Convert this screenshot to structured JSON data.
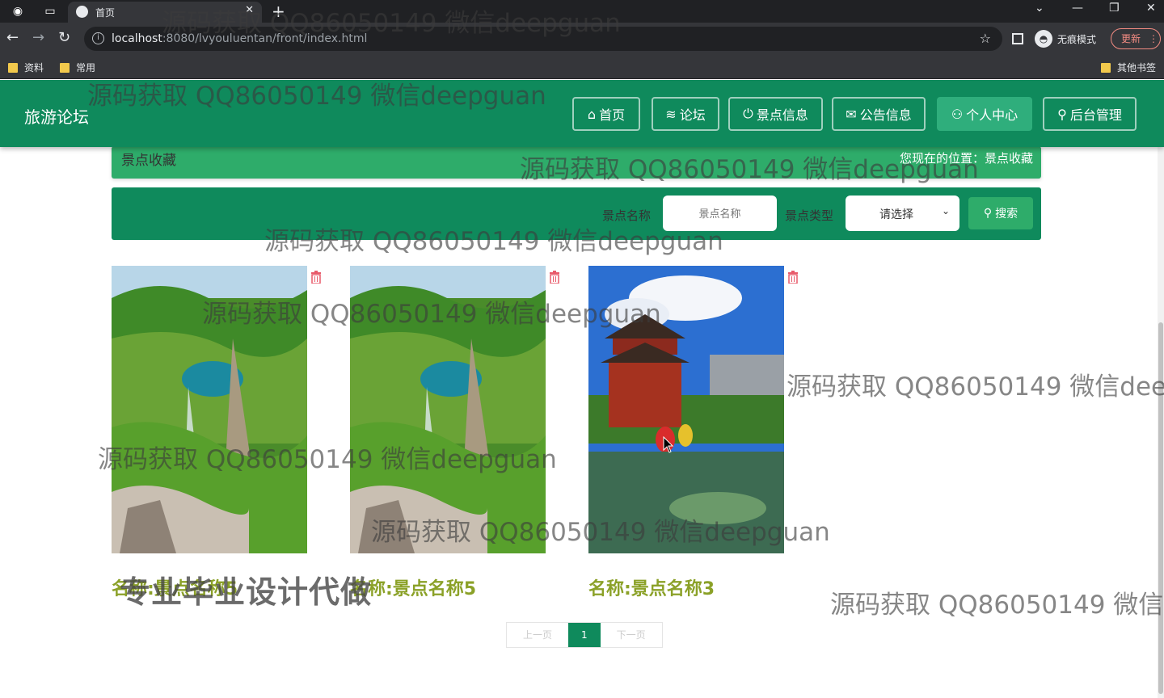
{
  "browser": {
    "tab_title": "首页",
    "url_host": "localhost",
    "url_rest": ":8080/lvyouluentan/front/index.html",
    "incognito_label": "无痕模式",
    "update_label": "更新",
    "bookmarks": [
      "资料",
      "常用"
    ],
    "other_bookmarks": "其他书签"
  },
  "site": {
    "logo": "旅游论坛",
    "nav": [
      {
        "label": "首页",
        "icon": "home-icon"
      },
      {
        "label": "论坛",
        "icon": "layers-icon"
      },
      {
        "label": "景点信息",
        "icon": "power-icon"
      },
      {
        "label": "公告信息",
        "icon": "mail-icon"
      },
      {
        "label": "个人中心",
        "icon": "user-icon",
        "active": true
      },
      {
        "label": "后台管理",
        "icon": "link-icon"
      }
    ]
  },
  "breadcrumb": {
    "title": "景点收藏",
    "location_prefix": "您现在的位置：",
    "location": "景点收藏"
  },
  "search": {
    "name_label": "景点名称",
    "name_placeholder": "景点名称",
    "type_label": "景点类型",
    "type_value": "请选择",
    "button": "搜索"
  },
  "cards": [
    {
      "name": "名称:景点名称5",
      "image": "waterfall-lake"
    },
    {
      "name": "名称:景点名称5",
      "image": "waterfall-lake"
    },
    {
      "name": "名称:景点名称3",
      "image": "pavilion-garden"
    }
  ],
  "pager": {
    "prev": "上一页",
    "current": "1",
    "next": "下一页"
  },
  "watermark": "源码获取 QQ86050149 微信deepguan",
  "watermark_big": "专业毕业设计代做"
}
